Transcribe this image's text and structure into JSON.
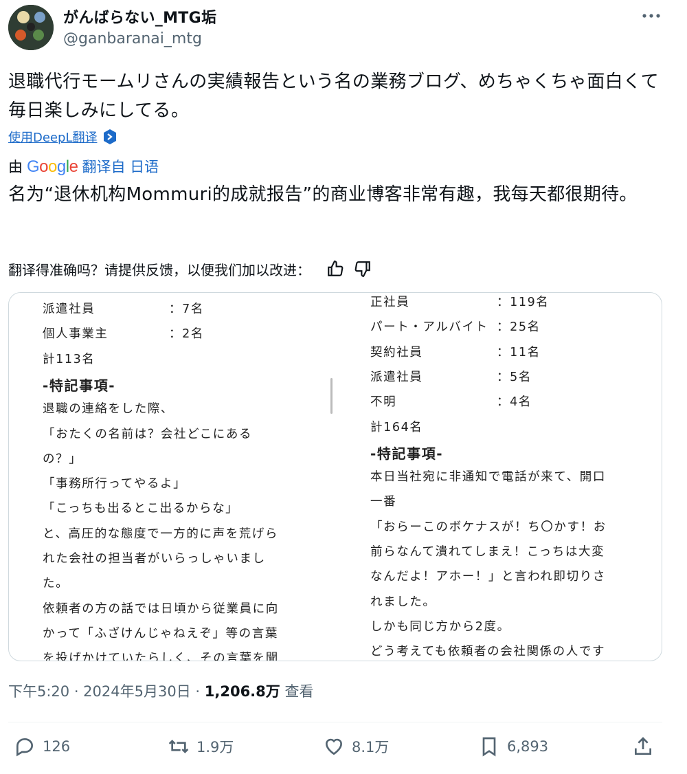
{
  "author": {
    "display_name": "がんばらない_MTG垢",
    "handle": "@ganbaranai_mtg"
  },
  "tweet": {
    "text": "退職代行モームリさんの実績報告という名の業務ブログ、めちゃくちゃ面白くて毎日楽しみにしてる。",
    "deepl_link": "使用DeepL翻译",
    "translation_prefix": "由",
    "translation_logo": [
      "G",
      "o",
      "o",
      "g",
      "l",
      "e"
    ],
    "translation_suffix": "翻译自 日语",
    "translated_text": "名为“退休机构Mommuri的成就报告”的商业博客非常有趣，我每天都很期待。",
    "feedback_prompt": "翻译得准确吗？请提供反馈，以便我们加以改进："
  },
  "media": {
    "left_lines": [
      {
        "k": "派遣社員",
        "v": "：7名"
      },
      {
        "k": "個人事業主",
        "v": "：2名"
      },
      {
        "k": "計113名"
      },
      {
        "k": "-特記事項-",
        "heading": true
      },
      {
        "k": "退職の連絡をした際、"
      },
      {
        "k": "「おたくの名前は？会社どこにある"
      },
      {
        "k": "の？」"
      },
      {
        "k": "「事務所行ってやるよ」"
      },
      {
        "k": "「こっちも出るとこ出るからな」"
      },
      {
        "k": "と、高圧的な態度で一方的に声を荒げら"
      },
      {
        "k": "れた会社の担当者がいらっしゃいまし"
      },
      {
        "k": "た。"
      },
      {
        "k": "依頼者の方の話では日頃から従業員に向"
      },
      {
        "k": "かって「ふざけんじゃねえぞ」等の言葉"
      },
      {
        "k": "を投げかけていたらしく、その言葉を聞"
      }
    ],
    "right_lines": [
      {
        "k": "正社員",
        "v": "：119名"
      },
      {
        "k": "パート・アルバイト",
        "v": "：25名"
      },
      {
        "k": "契約社員",
        "v": "：11名"
      },
      {
        "k": "派遣社員",
        "v": "：5名"
      },
      {
        "k": "不明",
        "v": "：4名"
      },
      {
        "k": "計164名"
      },
      {
        "k": "-特記事項-",
        "heading": true
      },
      {
        "k": "本日当社宛に非通知で電話が来て、開口"
      },
      {
        "k": "一番"
      },
      {
        "k": "「おらーこのボケナスが！ち〇かす！お"
      },
      {
        "k": "前らなんて潰れてしまえ！こっちは大変"
      },
      {
        "k": "なんだよ！アホー！」と言われ即切りさ"
      },
      {
        "k": "れました。"
      },
      {
        "k": "しかも同じ方から2度。"
      },
      {
        "k": "どう考えても依頼者の会社関係の人です"
      }
    ]
  },
  "meta": {
    "time": "下午5:20 · 2024年5月30日 · ",
    "views": "1,206.8万",
    "views_label": " 查看"
  },
  "actions": {
    "replies": "126",
    "reposts": "1.9万",
    "likes": "8.1万",
    "bookmarks": "6,893"
  },
  "icons": {
    "more": "more-horizontal-icon",
    "deepl": "deepl-icon",
    "thumbs_up": "thumbs-up-icon",
    "thumbs_down": "thumbs-down-icon",
    "reply": "reply-icon",
    "repost": "repost-icon",
    "like": "heart-icon",
    "bookmark": "bookmark-icon",
    "share": "share-icon"
  }
}
